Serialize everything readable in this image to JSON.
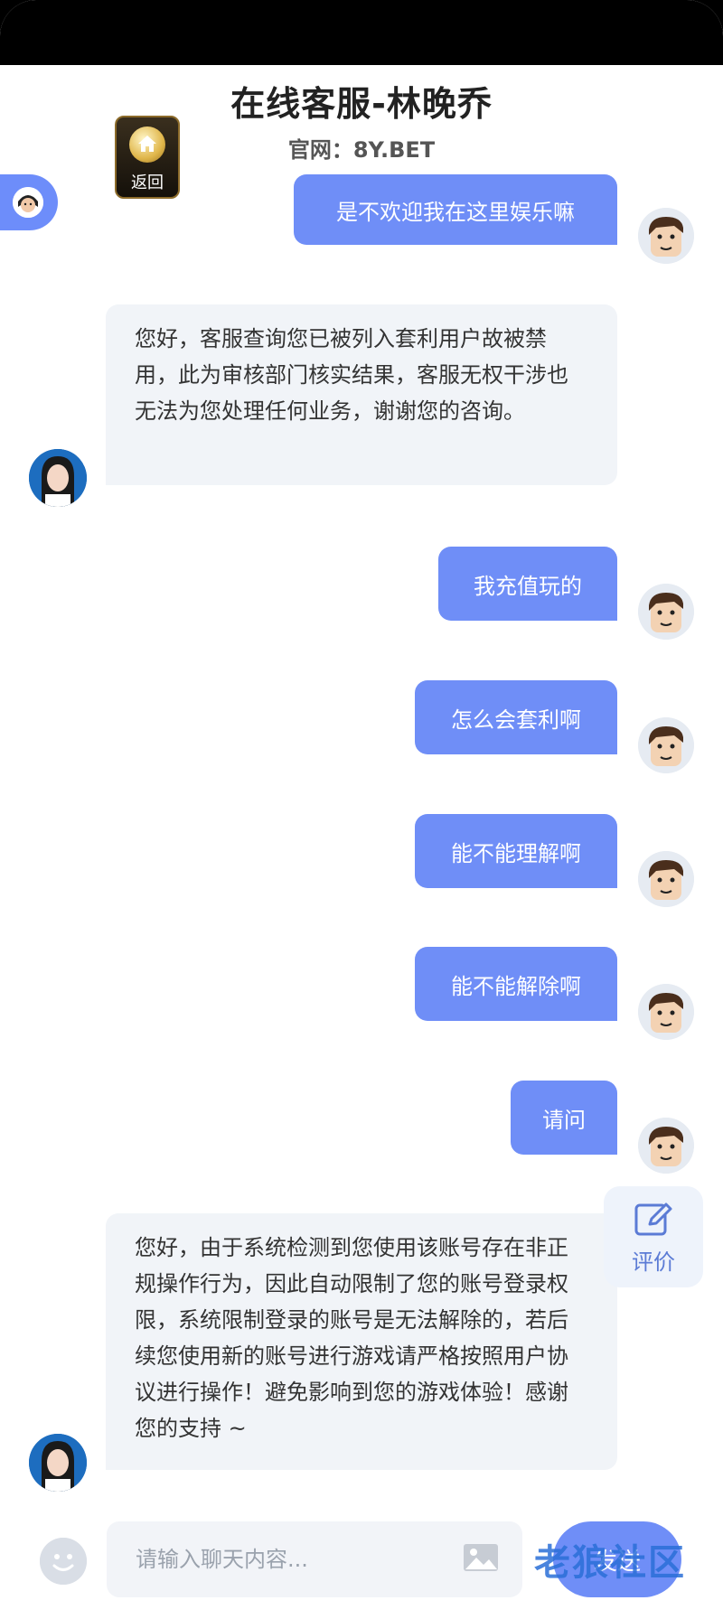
{
  "header": {
    "title": "在线客服-林晚乔",
    "subtitle": "官网：8Y.BET",
    "back_label": "返回"
  },
  "messages": [
    {
      "from": "user",
      "text": "是不欢迎我在这里娱乐嘛"
    },
    {
      "from": "agent",
      "text": "您好，客服查询您已被列入套利用户故被禁用，此为审核部门核实结果，客服无权干涉也无法为您处理任何业务，谢谢您的咨询。"
    },
    {
      "from": "user",
      "text": "我充值玩的"
    },
    {
      "from": "user",
      "text": "怎么会套利啊"
    },
    {
      "from": "user",
      "text": "能不能理解啊"
    },
    {
      "from": "user",
      "text": "能不能解除啊"
    },
    {
      "from": "user",
      "text": "请问"
    },
    {
      "from": "agent",
      "text": "您好，由于系统检测到您使用该账号存在非正规操作行为，因此自动限制了您的账号登录权限，系统限制登录的账号是无法解除的，若后续您使用新的账号进行游戏请严格按照用户协议进行操作！避免影响到您的游戏体验！感谢您的支持 ~"
    }
  ],
  "rate_label": "评价",
  "composer": {
    "placeholder": "请输入聊天内容...",
    "send_label": "发送"
  },
  "watermark": "老狼社区",
  "colors": {
    "accent": "#6f8ef7",
    "agent_bubble": "#f1f4f8"
  }
}
